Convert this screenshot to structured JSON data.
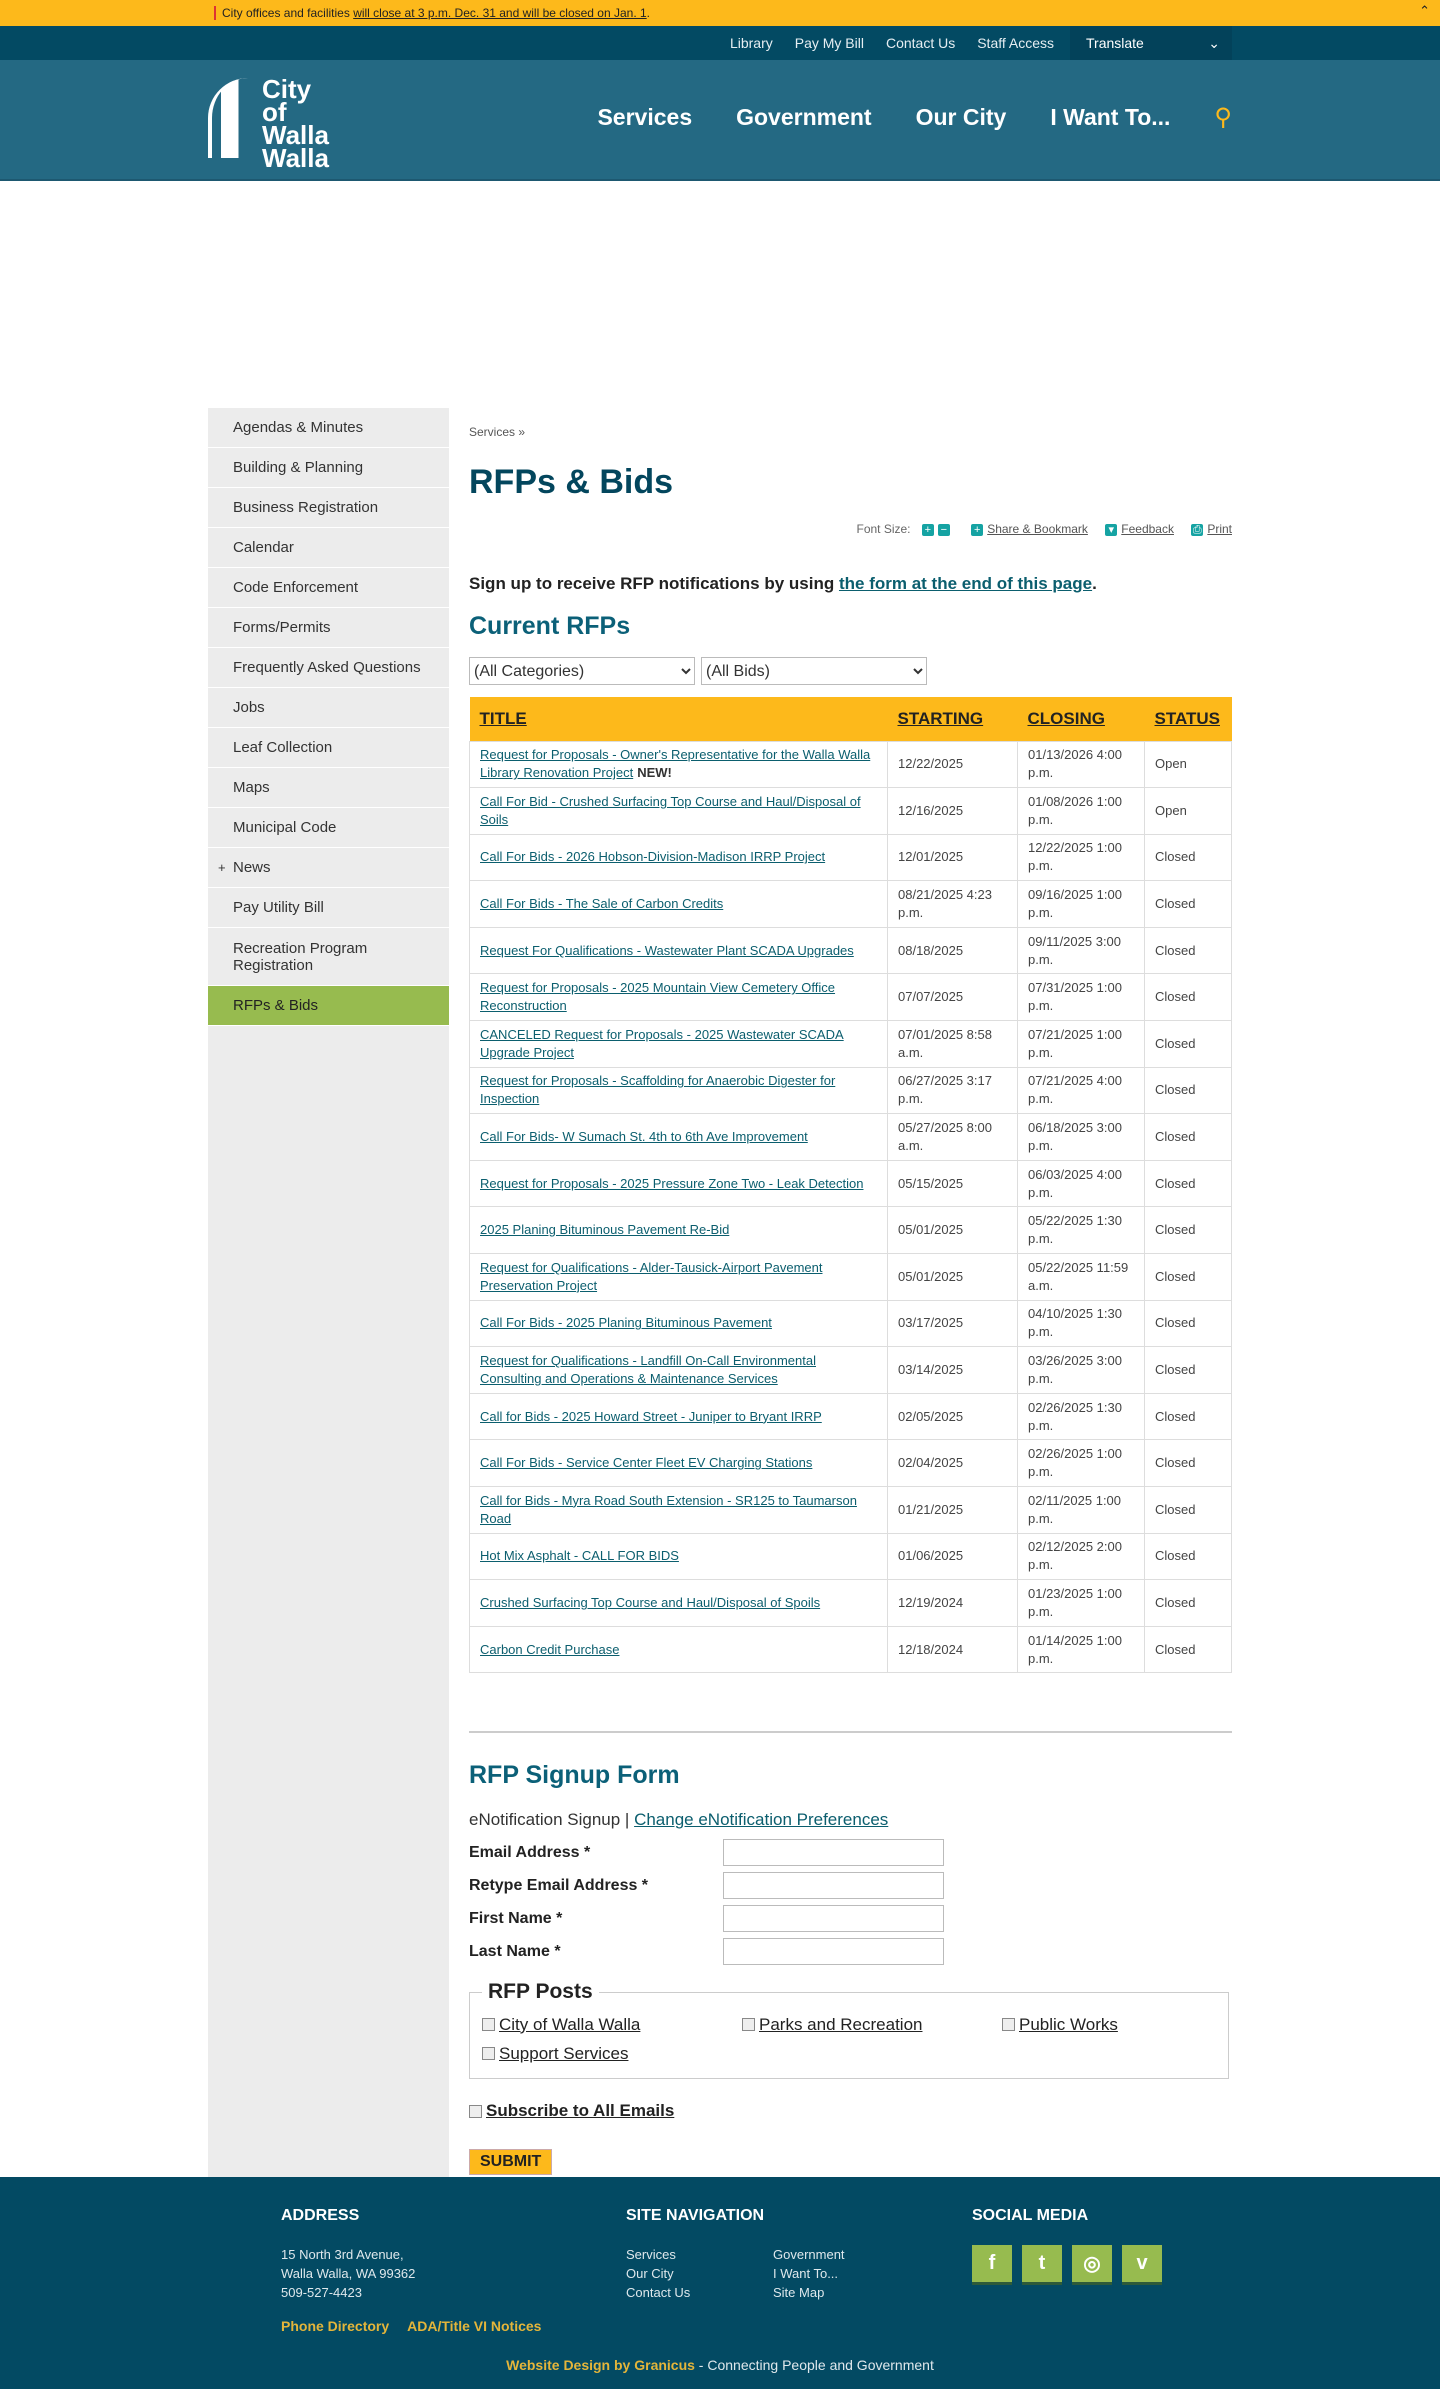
{
  "alert": {
    "text": "City offices and facilities ",
    "link": "will close at 3 p.m. Dec. 31 and will be closed on Jan. 1",
    "end": "."
  },
  "topnav": {
    "items": [
      "Library",
      "Pay My Bill",
      "Contact Us",
      "Staff Access"
    ],
    "translate": "Translate"
  },
  "logo": {
    "text": "City of Walla Walla"
  },
  "mainnav": [
    "Services",
    "Government",
    "Our City",
    "I Want To..."
  ],
  "sidebar": [
    "Agendas & Minutes",
    "Building & Planning",
    "Business Registration",
    "Calendar",
    "Code Enforcement",
    "Forms/Permits",
    "Frequently Asked Questions",
    "Jobs",
    "Leaf Collection",
    "Maps",
    "Municipal Code",
    "News",
    "Pay Utility Bill",
    "Recreation Program Registration",
    "RFPs & Bids"
  ],
  "breadcrumb": "Services »",
  "title": "RFPs & Bids",
  "tools": {
    "font_size": "Font Size:",
    "share": "Share & Bookmark",
    "feedback": "Feedback",
    "print": "Print"
  },
  "signup": {
    "text": "Sign up to receive RFP notifications by using ",
    "link": "the form at the end of this page",
    "end": "."
  },
  "current_heading": "Current RFPs",
  "filters": {
    "category": "(All Categories)",
    "bids": "(All Bids)"
  },
  "table": {
    "headers": [
      "TITLE",
      "STARTING",
      "CLOSING",
      "STATUS"
    ],
    "new_label": "NEW!",
    "rows": [
      [
        "Request for Proposals - Owner's Representative for the Walla Walla Library Renovation Project",
        "12/22/2025",
        "01/13/2026 4:00 p.m.",
        "Open"
      ],
      [
        "Call For Bid - Crushed Surfacing Top Course and Haul/Disposal of Soils",
        "12/16/2025",
        "01/08/2026 1:00 p.m.",
        "Open"
      ],
      [
        "Call For Bids - 2026 Hobson-Division-Madison IRRP Project",
        "12/01/2025",
        "12/22/2025 1:00 p.m.",
        "Closed"
      ],
      [
        "Call For Bids - The Sale of Carbon Credits",
        "08/21/2025 4:23 p.m.",
        "09/16/2025 1:00 p.m.",
        "Closed"
      ],
      [
        "Request For Qualifications - Wastewater Plant SCADA Upgrades",
        "08/18/2025",
        "09/11/2025 3:00 p.m.",
        "Closed"
      ],
      [
        "Request for Proposals - 2025 Mountain View Cemetery Office Reconstruction",
        "07/07/2025",
        "07/31/2025 1:00 p.m.",
        "Closed"
      ],
      [
        "CANCELED Request for Proposals - 2025 Wastewater SCADA Upgrade Project",
        "07/01/2025 8:58 a.m.",
        "07/21/2025 1:00 p.m.",
        "Closed"
      ],
      [
        "Request for Proposals - Scaffolding for Anaerobic Digester for Inspection",
        "06/27/2025 3:17 p.m.",
        "07/21/2025 4:00 p.m.",
        "Closed"
      ],
      [
        "Call For Bids- W Sumach St. 4th to 6th Ave Improvement",
        "05/27/2025 8:00 a.m.",
        "06/18/2025 3:00 p.m.",
        "Closed"
      ],
      [
        "Request for Proposals - 2025 Pressure Zone Two - Leak Detection",
        "05/15/2025",
        "06/03/2025 4:00 p.m.",
        "Closed"
      ],
      [
        "2025 Planing Bituminous Pavement Re-Bid",
        "05/01/2025",
        "05/22/2025 1:30 p.m.",
        "Closed"
      ],
      [
        "Request for Qualifications - Alder-Tausick-Airport Pavement Preservation Project",
        "05/01/2025",
        "05/22/2025 11:59 a.m.",
        "Closed"
      ],
      [
        "Call For Bids - 2025 Planing Bituminous Pavement",
        "03/17/2025",
        "04/10/2025 1:30 p.m.",
        "Closed"
      ],
      [
        "Request for Qualifications - Landfill On-Call Environmental Consulting and Operations & Maintenance Services",
        "03/14/2025",
        "03/26/2025 3:00 p.m.",
        "Closed"
      ],
      [
        "Call for Bids - 2025 Howard Street - Juniper to Bryant IRRP",
        "02/05/2025",
        "02/26/2025 1:30 p.m.",
        "Closed"
      ],
      [
        "Call For Bids - Service Center Fleet EV Charging Stations",
        "02/04/2025",
        "02/26/2025 1:00 p.m.",
        "Closed"
      ],
      [
        "Call for Bids - Myra Road South Extension - SR125 to Taumarson Road",
        "01/21/2025",
        "02/11/2025 1:00 p.m.",
        "Closed"
      ],
      [
        "Hot Mix Asphalt - CALL FOR BIDS",
        "01/06/2025",
        "02/12/2025 2:00 p.m.",
        "Closed"
      ],
      [
        "Crushed Surfacing Top Course and Haul/Disposal of Spoils",
        "12/19/2024",
        "01/23/2025 1:00 p.m.",
        "Closed"
      ],
      [
        "Carbon Credit Purchase",
        "12/18/2024",
        "01/14/2025 1:00 p.m.",
        "Closed"
      ]
    ]
  },
  "form": {
    "heading": "RFP Signup Form",
    "enot": "eNotification Signup | ",
    "enot_link": "Change eNotification Preferences",
    "fields": [
      "Email Address *",
      "Retype Email Address *",
      "First Name *",
      "Last Name *"
    ],
    "legend": "RFP Posts",
    "posts": [
      "City of Walla Walla",
      "Parks and Recreation",
      "Public Works",
      "Support Services"
    ],
    "subscribe_all": "Subscribe to All Emails",
    "submit": "SUBMIT"
  },
  "footer": {
    "address_h": "ADDRESS",
    "address": [
      "15 North 3rd Avenue,",
      "Walla Walla, WA 99362",
      "509-527-4423"
    ],
    "links": [
      "Phone Directory",
      "ADA/Title VI Notices"
    ],
    "nav_h": "SITE NAVIGATION",
    "nav": [
      "Services",
      "Government",
      "Our City",
      "I Want To...",
      "Contact Us",
      "Site Map"
    ],
    "social_h": "SOCIAL MEDIA",
    "credit_link": "Website Design by Granicus",
    "credit": " - Connecting People and Government"
  }
}
